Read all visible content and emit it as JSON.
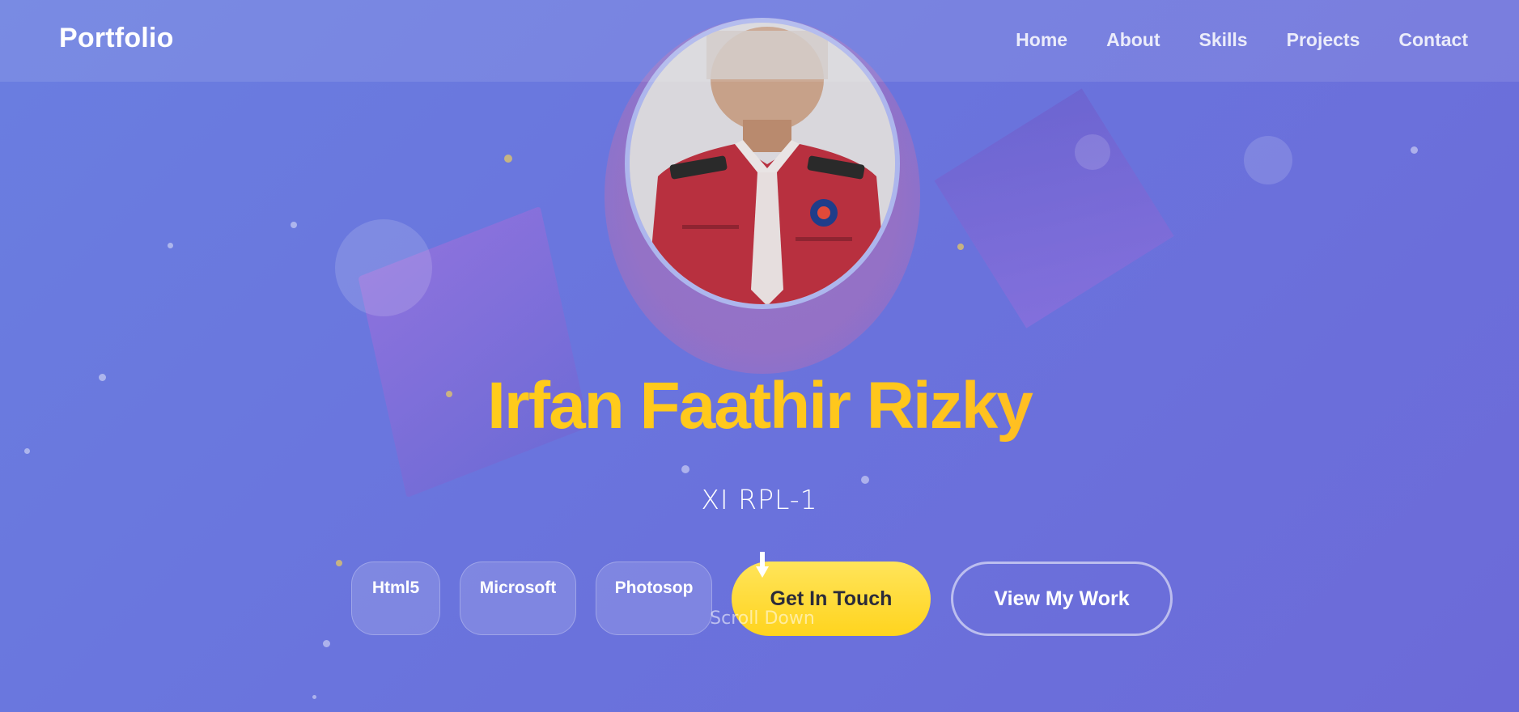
{
  "nav": {
    "brand": "Portfolio",
    "links": [
      "Home",
      "About",
      "Skills",
      "Projects",
      "Contact"
    ]
  },
  "hero": {
    "name": "Irfan Faathir Rizky",
    "subtitle": "XI RPL-1",
    "skills": [
      "Html5",
      "Microsoft",
      "Photosop"
    ],
    "primary_button": "Get In Touch",
    "secondary_button": "View My Work",
    "scroll_label": "Scroll Down"
  },
  "colors": {
    "background_start": "#6a7ee0",
    "background_end": "#6c6ad8",
    "name_gradient_start": "#ffd21a",
    "name_gradient_end": "#ff9f3a",
    "primary_button": "#ffd41e"
  }
}
